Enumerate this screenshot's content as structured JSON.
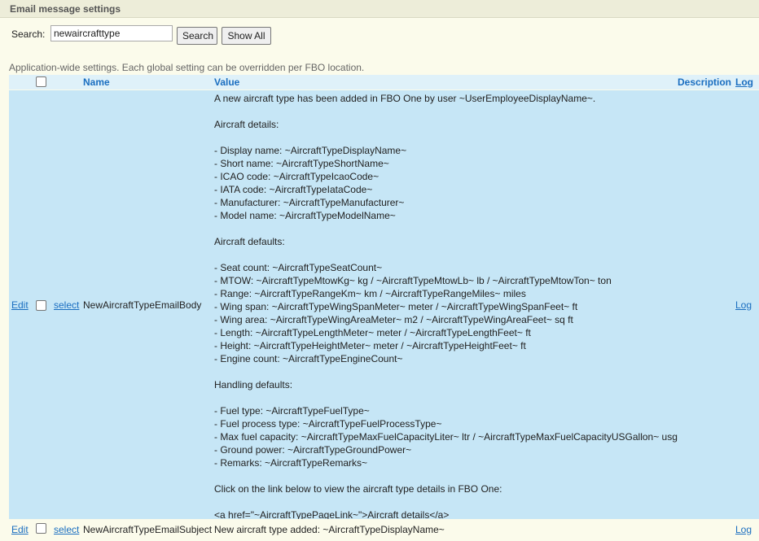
{
  "window": {
    "title": "Email message settings"
  },
  "search": {
    "label": "Search:",
    "value": "newaircrafttype",
    "search_button": "Search",
    "show_all_button": "Show All"
  },
  "hint": "Application-wide settings. Each global setting can be overridden per FBO location.",
  "table": {
    "headers": {
      "name": "Name",
      "value": "Value",
      "description": "Description",
      "log": "Log"
    },
    "rows": [
      {
        "edit": "Edit",
        "select": "select",
        "name": "NewAircraftTypeEmailBody",
        "log": "Log",
        "value": "A new aircraft type has been added in FBO One by user ~UserEmployeeDisplayName~.\n\nAircraft details:\n\n- Display name: ~AircraftTypeDisplayName~\n- Short name: ~AircraftTypeShortName~\n- ICAO code: ~AircraftTypeIcaoCode~\n- IATA code: ~AircraftTypeIataCode~\n- Manufacturer: ~AircraftTypeManufacturer~\n- Model name: ~AircraftTypeModelName~\n\nAircraft defaults:\n\n- Seat count: ~AircraftTypeSeatCount~\n- MTOW: ~AircraftTypeMtowKg~ kg / ~AircraftTypeMtowLb~ lb / ~AircraftTypeMtowTon~ ton\n- Range: ~AircraftTypeRangeKm~ km / ~AircraftTypeRangeMiles~ miles\n- Wing span: ~AircraftTypeWingSpanMeter~ meter / ~AircraftTypeWingSpanFeet~ ft\n- Wing area: ~AircraftTypeWingAreaMeter~ m2 / ~AircraftTypeWingAreaFeet~ sq ft\n- Length: ~AircraftTypeLengthMeter~ meter / ~AircraftTypeLengthFeet~ ft\n- Height: ~AircraftTypeHeightMeter~ meter / ~AircraftTypeHeightFeet~ ft\n- Engine count: ~AircraftTypeEngineCount~\n\nHandling defaults:\n\n- Fuel type: ~AircraftTypeFuelType~\n- Fuel process type: ~AircraftTypeFuelProcessType~\n- Max fuel capacity: ~AircraftTypeMaxFuelCapacityLiter~ ltr / ~AircraftTypeMaxFuelCapacityUSGallon~ usg\n- Ground power: ~AircraftTypeGroundPower~\n- Remarks: ~AircraftTypeRemarks~\n\nClick on the link below to view the aircraft type details in FBO One:\n\n<a href=\"~AircraftTypePageLink~\">Aircraft details</a>"
      },
      {
        "edit": "Edit",
        "select": "select",
        "name": "NewAircraftTypeEmailSubject",
        "log": "Log",
        "value": "New aircraft type added: ~AircraftTypeDisplayName~"
      }
    ]
  },
  "colors": {
    "page_bg": "#fbfbeb",
    "title_bar_bg": "#ededd9",
    "header_bg": "#dff1f9",
    "selected_row_bg": "#c6e6f6",
    "link": "#1a6ec0"
  }
}
